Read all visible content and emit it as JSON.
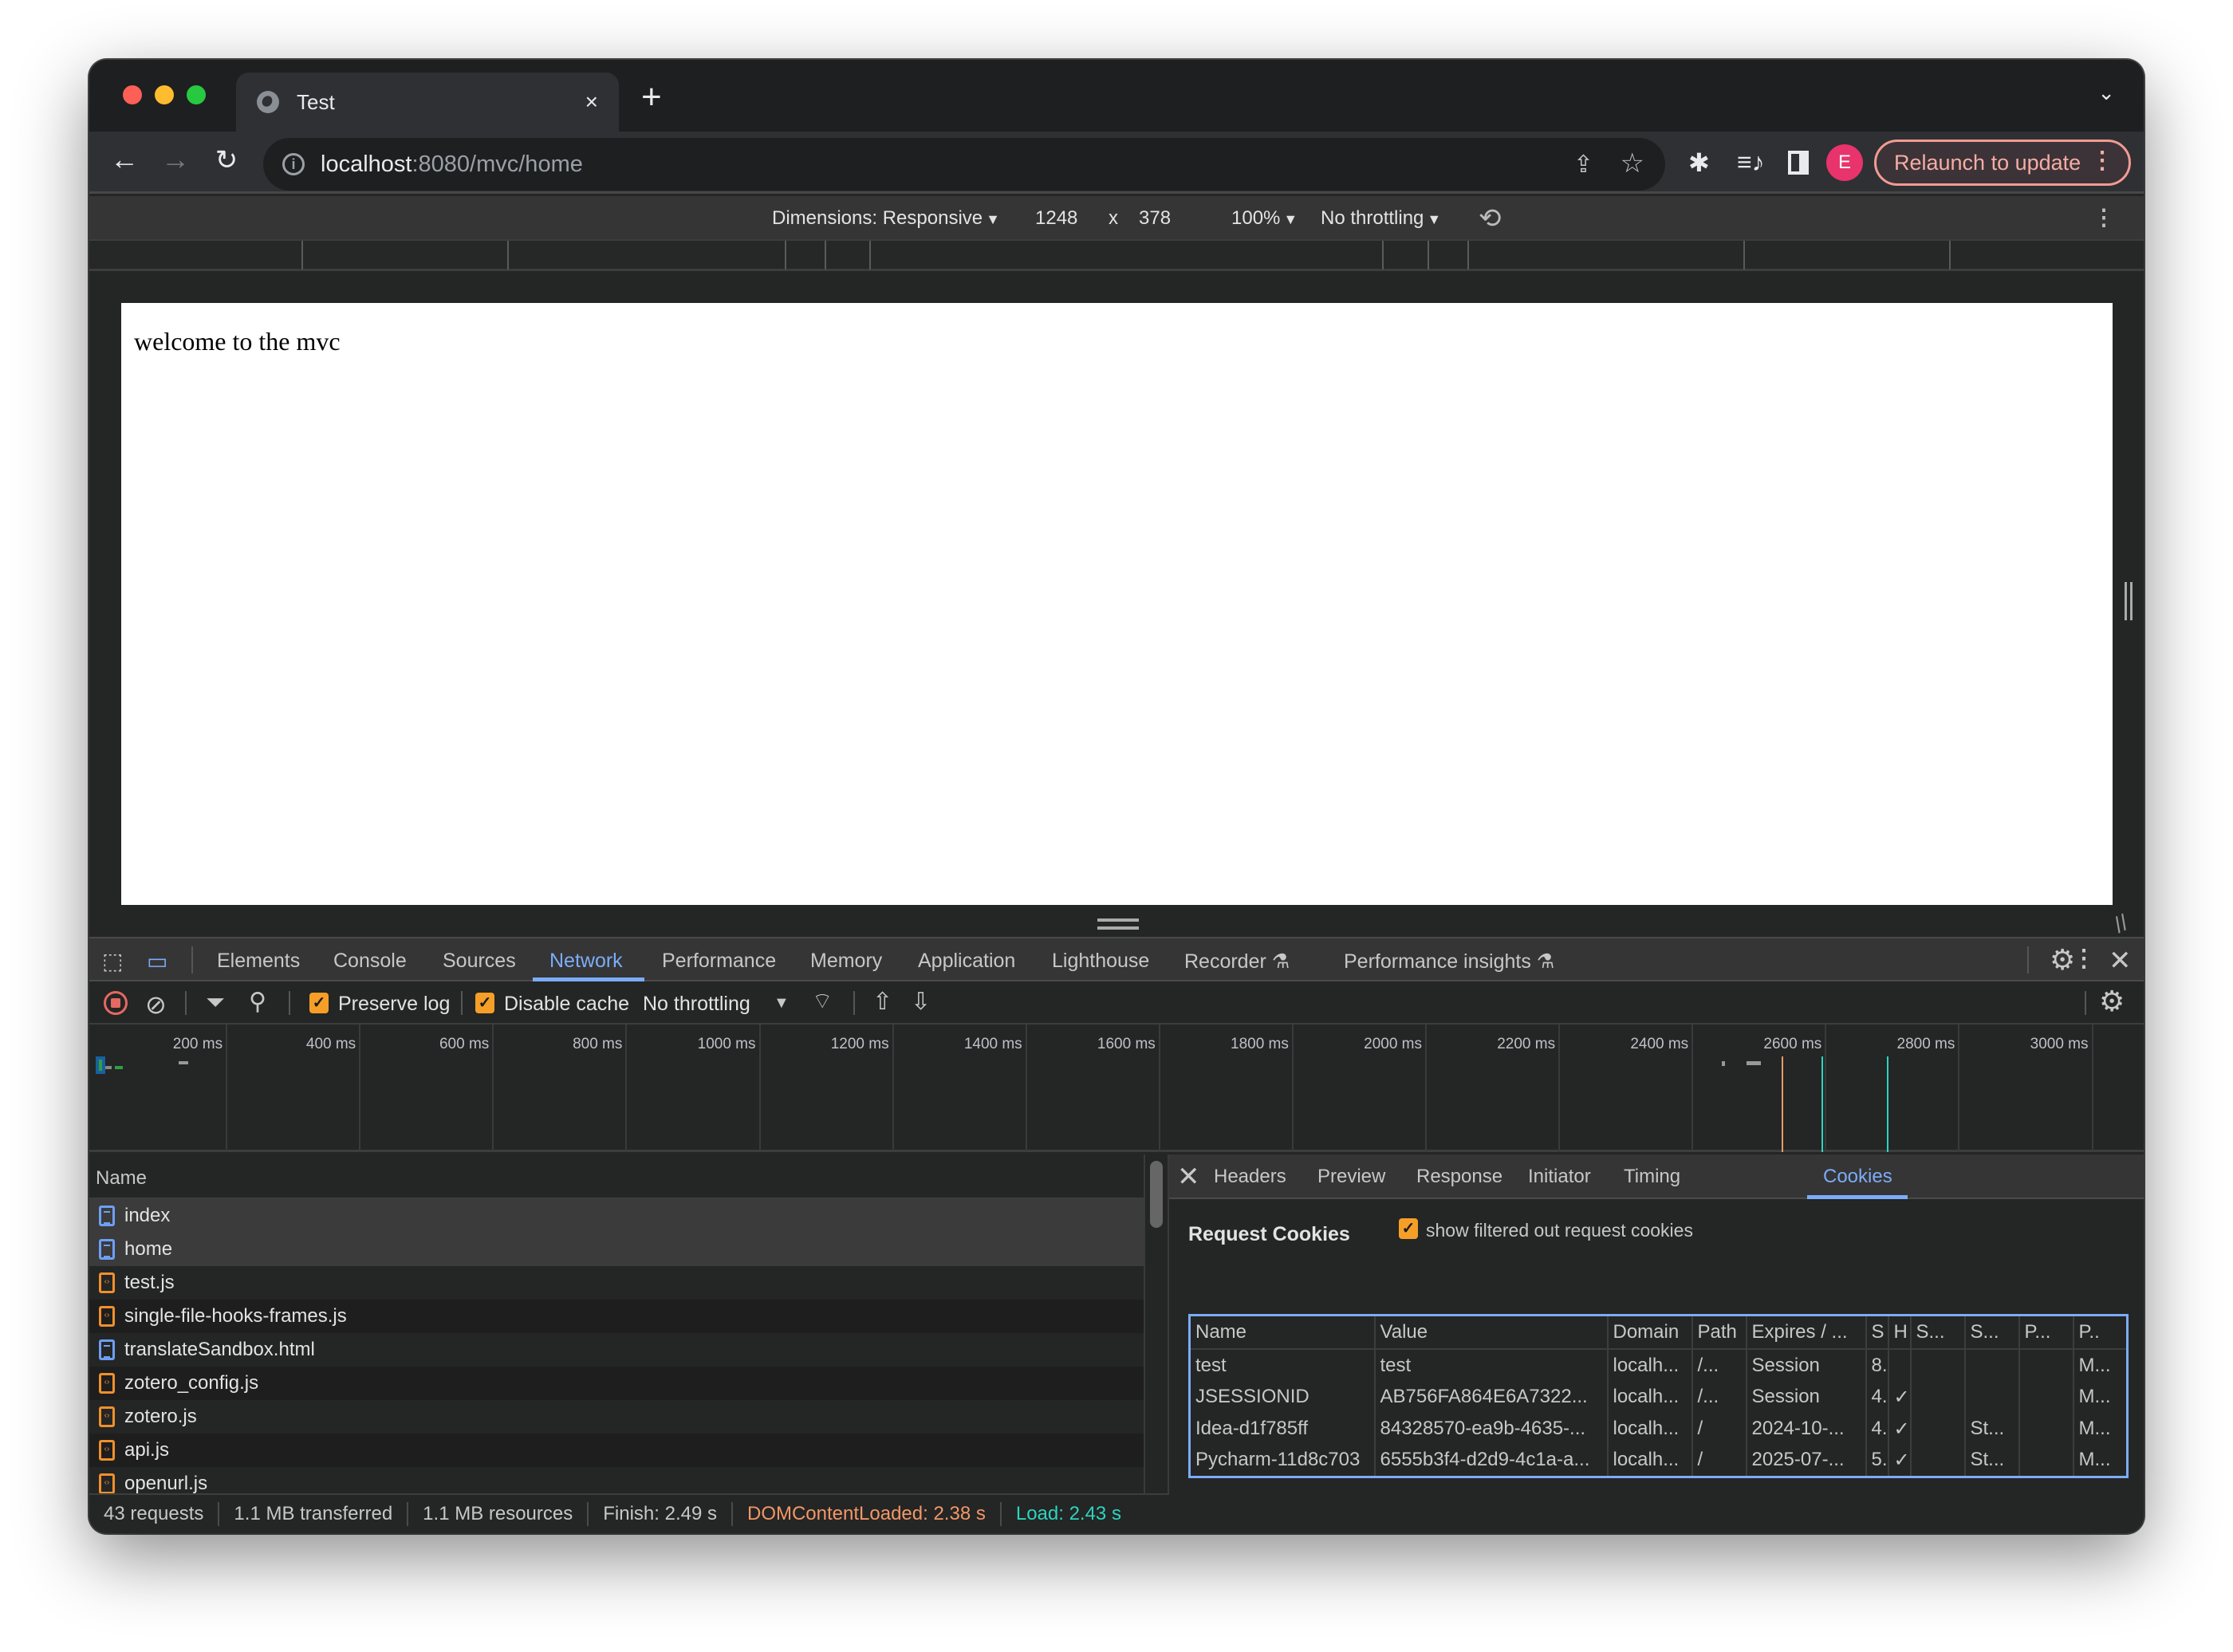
{
  "browser": {
    "tab_title": "Test",
    "url_host": "localhost",
    "url_rest": ":8080/mvc/home",
    "profile_initial": "E",
    "relaunch_label": "Relaunch to update"
  },
  "device_toolbar": {
    "dimensions_label": "Dimensions: Responsive",
    "width": "1248",
    "times": "x",
    "height": "378",
    "zoom": "100%",
    "throttling": "No throttling"
  },
  "page": {
    "body_text": "welcome to the mvc"
  },
  "devtools": {
    "tabs": [
      "Elements",
      "Console",
      "Sources",
      "Network",
      "Performance",
      "Memory",
      "Application",
      "Lighthouse",
      "Recorder",
      "Performance insights"
    ],
    "active_tab": "Network",
    "network_toolbar": {
      "preserve_log": "Preserve log",
      "preserve_log_checked": true,
      "disable_cache": "Disable cache",
      "disable_cache_checked": true,
      "throttling": "No throttling"
    },
    "timeline_ticks": [
      "200 ms",
      "400 ms",
      "600 ms",
      "800 ms",
      "1000 ms",
      "1200 ms",
      "1400 ms",
      "1600 ms",
      "1800 ms",
      "2000 ms",
      "2200 ms",
      "2400 ms",
      "2600 ms",
      "2800 ms",
      "3000 ms"
    ],
    "timeline_markers": {
      "dom_content_loaded_ms": 2380,
      "load_ms": 2430,
      "finish_ms": 2490
    },
    "request_list": {
      "header": "Name",
      "rows": [
        {
          "name": "index",
          "type": "document"
        },
        {
          "name": "home",
          "type": "document"
        },
        {
          "name": "test.js",
          "type": "script"
        },
        {
          "name": "single-file-hooks-frames.js",
          "type": "script"
        },
        {
          "name": "translateSandbox.html",
          "type": "document"
        },
        {
          "name": "zotero_config.js",
          "type": "script"
        },
        {
          "name": "zotero.js",
          "type": "script"
        },
        {
          "name": "api.js",
          "type": "script"
        },
        {
          "name": "openurl.js",
          "type": "script"
        }
      ]
    },
    "detail_tabs": [
      "Headers",
      "Preview",
      "Response",
      "Initiator",
      "Timing",
      "Cookies"
    ],
    "active_detail_tab": "Cookies",
    "request_cookies": {
      "title": "Request Cookies",
      "show_filtered_label": "show filtered out request cookies",
      "show_filtered_checked": true,
      "columns": [
        "Name",
        "Value",
        "Domain",
        "Path",
        "Expires / ...",
        "S",
        "H",
        "S...",
        "S...",
        "P...",
        "P.."
      ],
      "rows": [
        [
          "test",
          "test",
          "localh...",
          "/...",
          "Session",
          "8.",
          "",
          "",
          "",
          "",
          "M..."
        ],
        [
          "JSESSIONID",
          "AB756FA864E6A7322...",
          "localh...",
          "/...",
          "Session",
          "4.",
          "✓",
          "",
          "",
          "",
          "M..."
        ],
        [
          "Idea-d1f785ff",
          "84328570-ea9b-4635-...",
          "localh...",
          "/",
          "2024-10-...",
          "4.",
          "✓",
          "",
          "St...",
          "",
          "M..."
        ],
        [
          "Pycharm-11d8c703",
          "6555b3f4-d2d9-4c1a-a...",
          "localh...",
          "/",
          "2025-07-...",
          "5.",
          "✓",
          "",
          "St...",
          "",
          "M..."
        ]
      ]
    },
    "status_bar": {
      "requests": "43 requests",
      "transferred": "1.1 MB transferred",
      "resources": "1.1 MB resources",
      "finish": "Finish: 2.49 s",
      "dom_content_loaded": "DOMContentLoaded: 2.38 s",
      "load": "Load: 2.43 s"
    }
  },
  "colors": {
    "accent": "#7cacf8",
    "dcl": "#f29766",
    "load": "#2dd4bf",
    "checkbox": "#f59f28",
    "record": "#e46962"
  }
}
